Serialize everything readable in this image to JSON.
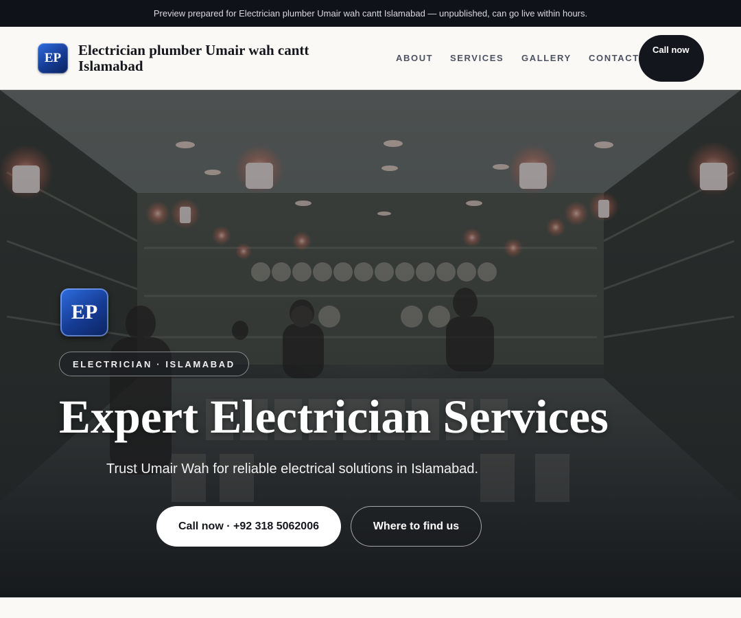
{
  "preview_bar": {
    "text": "Preview prepared for Electrician plumber Umair wah cantt Islamabad — unpublished, can go live within hours."
  },
  "header": {
    "logo_initials": "EP",
    "brand_name": "Electrician plumber Umair wah cantt Islamabad",
    "nav": [
      {
        "label": "ABOUT"
      },
      {
        "label": "SERVICES"
      },
      {
        "label": "GALLERY"
      },
      {
        "label": "CONTACT"
      }
    ],
    "call_button": "Call now"
  },
  "hero": {
    "logo_initials": "EP",
    "badge": "ELECTRICIAN · ISLAMABAD",
    "title": "Expert Electrician Services",
    "subtitle": "Trust Umair Wah for reliable electrical solutions in Islamabad.",
    "primary_button": "Call now · +92 318 5062006",
    "secondary_button": "Where to find us"
  },
  "colors": {
    "preview_bar_bg": "#0f1218",
    "logo_blue": "#1e4fb8",
    "dark_button": "#14161e",
    "page_bg": "#faf9f6"
  }
}
